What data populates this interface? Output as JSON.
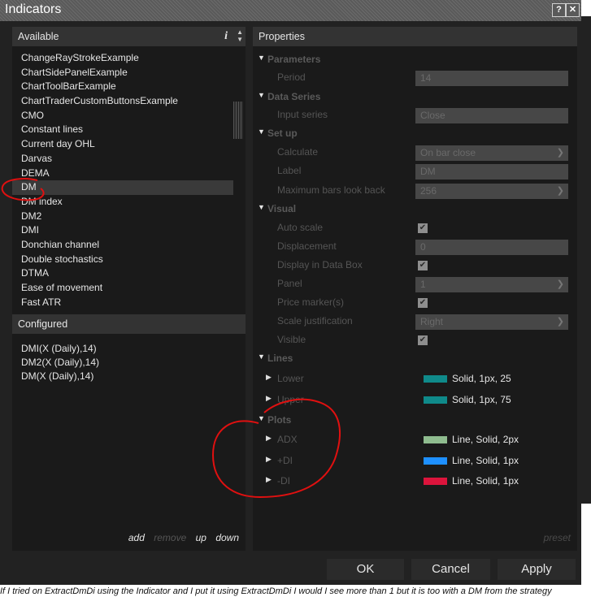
{
  "window": {
    "title": "Indicators",
    "help_btn": "?",
    "close_btn": "✕"
  },
  "available": {
    "header": "Available",
    "info_glyph": "i",
    "items": [
      "ChangeRayStrokeExample",
      "ChartSidePanelExample",
      "ChartToolBarExample",
      "ChartTraderCustomButtonsExample",
      "CMO",
      "Constant lines",
      "Current day OHL",
      "Darvas",
      "DEMA",
      "DM",
      "DM index",
      "DM2",
      "DMI",
      "Donchian channel",
      "Double stochastics",
      "DTMA",
      "Ease of movement",
      "Fast ATR"
    ],
    "selected": "DM"
  },
  "configured": {
    "header": "Configured",
    "items": [
      "DMI(X (Daily),14)",
      "DM2(X (Daily),14)",
      "DM(X (Daily),14)"
    ],
    "actions": {
      "add": "add",
      "remove": "remove",
      "up": "up",
      "down": "down"
    }
  },
  "properties": {
    "header": "Properties",
    "parameters": {
      "label": "Parameters",
      "period_label": "Period",
      "period_value": "14"
    },
    "data_series": {
      "label": "Data Series",
      "input_label": "Input series",
      "input_value": "Close"
    },
    "setup": {
      "label": "Set up",
      "calculate_label": "Calculate",
      "calculate_value": "On bar close",
      "label_label": "Label",
      "label_value": "DM",
      "maxbars_label": "Maximum bars look back",
      "maxbars_value": "256"
    },
    "visual": {
      "label": "Visual",
      "autoscale_label": "Auto scale",
      "displacement_label": "Displacement",
      "displacement_value": "0",
      "databox_label": "Display in Data Box",
      "panel_label": "Panel",
      "panel_value": "1",
      "pricemarker_label": "Price marker(s)",
      "scalejust_label": "Scale justification",
      "scalejust_value": "Right",
      "visible_label": "Visible"
    },
    "lines": {
      "label": "Lines",
      "lower_label": "Lower",
      "lower_desc": "Solid, 1px, 25",
      "upper_label": "Upper",
      "upper_desc": "Solid, 1px, 75",
      "lower_color": "#0f8a8a",
      "upper_color": "#0f8a8a"
    },
    "plots": {
      "label": "Plots",
      "adx_label": "ADX",
      "adx_desc": "Line, Solid, 2px",
      "adx_color": "#8fbc8f",
      "pdi_label": "+DI",
      "pdi_desc": "Line, Solid, 1px",
      "pdi_color": "#1e90ff",
      "mdi_label": "-DI",
      "mdi_desc": "Line, Solid, 1px",
      "mdi_color": "#dc143c"
    },
    "preset": "preset"
  },
  "buttons": {
    "ok": "OK",
    "cancel": "Cancel",
    "apply": "Apply"
  },
  "footer": "If I tried on ExtractDmDi using the Indicator and I put it using ExtractDmDi I would I see more than 1 but it is too with a DM from the strategy"
}
